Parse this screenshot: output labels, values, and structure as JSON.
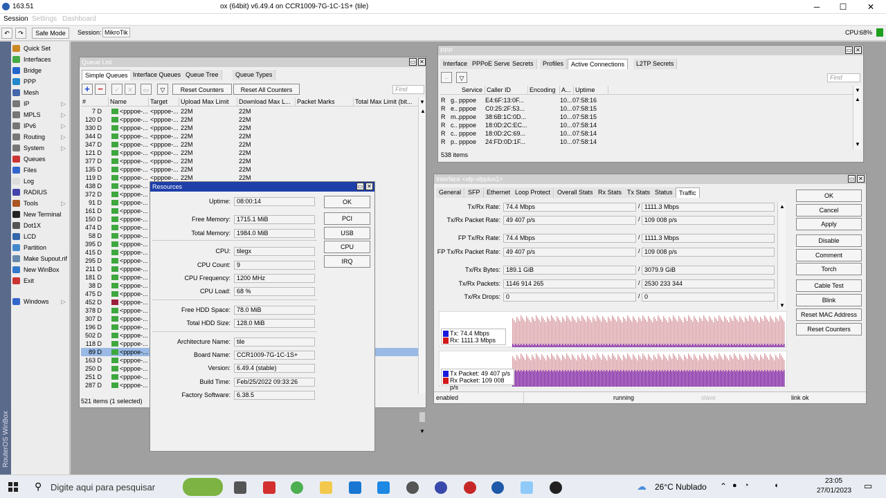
{
  "titlebar": {
    "left": "163.51",
    "title": "ox (64bit) v6.49.4 on CCR1009-7G-1C-1S+ (tile)",
    "min": "─",
    "max": "☐",
    "close": "✕"
  },
  "menu": {
    "session": "Session",
    "settings": "Settings",
    "dashboard": "Dashboard"
  },
  "toolbar": {
    "undo": "↶",
    "redo": "↷",
    "safe_mode": "Safe Mode",
    "session_label": "Session:",
    "session_value": "MikroTik",
    "cpu_label": "CPU:",
    "cpu_value": "68%"
  },
  "sidebar": {
    "brand": "RouterOS WinBox",
    "items": [
      {
        "label": "Quick Set",
        "color": "#cc8822",
        "arrow": ""
      },
      {
        "label": "Interfaces",
        "color": "#44aa44",
        "arrow": ""
      },
      {
        "label": "Bridge",
        "color": "#2266cc",
        "arrow": ""
      },
      {
        "label": "PPP",
        "color": "#2288cc",
        "arrow": ""
      },
      {
        "label": "Mesh",
        "color": "#4466aa",
        "arrow": ""
      },
      {
        "label": "IP",
        "color": "#777777",
        "arrow": "▷"
      },
      {
        "label": "MPLS",
        "color": "#777777",
        "arrow": "▷"
      },
      {
        "label": "IPv6",
        "color": "#777777",
        "arrow": "▷"
      },
      {
        "label": "Routing",
        "color": "#777777",
        "arrow": "▷"
      },
      {
        "label": "System",
        "color": "#777777",
        "arrow": "▷"
      },
      {
        "label": "Queues",
        "color": "#cc3333",
        "arrow": ""
      },
      {
        "label": "Files",
        "color": "#3366cc",
        "arrow": ""
      },
      {
        "label": "Log",
        "color": "#dddddd",
        "arrow": ""
      },
      {
        "label": "RADIUS",
        "color": "#4444aa",
        "arrow": ""
      },
      {
        "label": "Tools",
        "color": "#aa5522",
        "arrow": "▷"
      },
      {
        "label": "New Terminal",
        "color": "#222222",
        "arrow": ""
      },
      {
        "label": "Dot1X",
        "color": "#555555",
        "arrow": ""
      },
      {
        "label": "LCD",
        "color": "#3366aa",
        "arrow": ""
      },
      {
        "label": "Partition",
        "color": "#4488cc",
        "arrow": ""
      },
      {
        "label": "Make Supout.rif",
        "color": "#6688aa",
        "arrow": ""
      },
      {
        "label": "New WinBox",
        "color": "#3377cc",
        "arrow": ""
      },
      {
        "label": "Exit",
        "color": "#cc3333",
        "arrow": ""
      },
      {
        "label": "Windows",
        "color": "#3366cc",
        "arrow": "▷"
      }
    ]
  },
  "queue_list": {
    "title": "Queue List",
    "tabs": [
      "Simple Queues",
      "Interface Queues",
      "Queue Tree",
      "Queue Types"
    ],
    "reset_counters": "Reset Counters",
    "reset_all_counters": "Reset All Counters",
    "find": "Find",
    "columns": [
      "#",
      "Name",
      "Target",
      "Upload Max Limit",
      "Download Max L...",
      "Packet Marks",
      "Total Max Limit (bit..."
    ],
    "rows": [
      {
        "num": "7 D",
        "name": "<pppoe-...",
        "target": "<pppoe-...",
        "up": "22M",
        "down": "22M"
      },
      {
        "num": "120 D",
        "name": "<pppoe-...",
        "target": "<pppoe-...",
        "up": "22M",
        "down": "22M"
      },
      {
        "num": "330 D",
        "name": "<pppoe-...",
        "target": "<pppoe-...",
        "up": "22M",
        "down": "22M"
      },
      {
        "num": "344 D",
        "name": "<pppoe-...",
        "target": "<pppoe-...",
        "up": "22M",
        "down": "22M"
      },
      {
        "num": "347 D",
        "name": "<pppoe-...",
        "target": "<pppoe-...",
        "up": "22M",
        "down": "22M"
      },
      {
        "num": "121 D",
        "name": "<pppoe-...",
        "target": "<pppoe-...",
        "up": "22M",
        "down": "22M"
      },
      {
        "num": "377 D",
        "name": "<pppoe-...",
        "target": "<pppoe-...",
        "up": "22M",
        "down": "22M"
      },
      {
        "num": "135 D",
        "name": "<pppoe-...",
        "target": "<pppoe-...",
        "up": "22M",
        "down": "22M"
      },
      {
        "num": "119 D",
        "name": "<pppoe-...",
        "target": "<pppoe-...",
        "up": "22M",
        "down": "22M"
      },
      {
        "num": "438 D",
        "name": "<pppoe-...",
        "target": "",
        "up": "",
        "down": ""
      },
      {
        "num": "372 D",
        "name": "<pppoe-...",
        "target": "",
        "up": "",
        "down": ""
      },
      {
        "num": "91 D",
        "name": "<pppoe-...",
        "target": "",
        "up": "",
        "down": ""
      },
      {
        "num": "161 D",
        "name": "<pppoe-...",
        "target": "",
        "up": "",
        "down": ""
      },
      {
        "num": "150 D",
        "name": "<pppoe-...",
        "target": "",
        "up": "",
        "down": ""
      },
      {
        "num": "474 D",
        "name": "<pppoe-...",
        "target": "",
        "up": "",
        "down": ""
      },
      {
        "num": "58 D",
        "name": "<pppoe-...",
        "target": "",
        "up": "",
        "down": ""
      },
      {
        "num": "395 D",
        "name": "<pppoe-...",
        "target": "",
        "up": "",
        "down": ""
      },
      {
        "num": "415 D",
        "name": "<pppoe-...",
        "target": "",
        "up": "",
        "down": ""
      },
      {
        "num": "295 D",
        "name": "<pppoe-...",
        "target": "",
        "up": "",
        "down": ""
      },
      {
        "num": "211 D",
        "name": "<pppoe-...",
        "target": "",
        "up": "",
        "down": ""
      },
      {
        "num": "181 D",
        "name": "<pppoe-...",
        "target": "",
        "up": "",
        "down": ""
      },
      {
        "num": "38 D",
        "name": "<pppoe-...",
        "target": "",
        "up": "",
        "down": ""
      },
      {
        "num": "475 D",
        "name": "<pppoe-...",
        "target": "",
        "up": "",
        "down": ""
      },
      {
        "num": "452 D",
        "name": "<pppoe-...",
        "target": "",
        "up": "",
        "down": ""
      },
      {
        "num": "378 D",
        "name": "<pppoe-...",
        "target": "",
        "up": "",
        "down": ""
      },
      {
        "num": "307 D",
        "name": "<pppoe-...",
        "target": "",
        "up": "",
        "down": ""
      },
      {
        "num": "196 D",
        "name": "<pppoe-...",
        "target": "",
        "up": "",
        "down": ""
      },
      {
        "num": "502 D",
        "name": "<pppoe-...",
        "target": "",
        "up": "",
        "down": ""
      },
      {
        "num": "118 D",
        "name": "<pppoe-...",
        "target": "",
        "up": "",
        "down": ""
      },
      {
        "num": "89 D",
        "name": "<pppoe-...",
        "target": "",
        "up": "",
        "down": ""
      },
      {
        "num": "163 D",
        "name": "<pppoe-...",
        "target": "",
        "up": "",
        "down": ""
      },
      {
        "num": "250 D",
        "name": "<pppoe-...",
        "target": "",
        "up": "",
        "down": ""
      },
      {
        "num": "251 D",
        "name": "<pppoe-...",
        "target": "",
        "up": "",
        "down": ""
      },
      {
        "num": "287 D",
        "name": "<pppoe-...",
        "target": "",
        "up": "",
        "down": ""
      }
    ],
    "selected_index": 29,
    "status": "521 items (1 selected)"
  },
  "resources": {
    "title": "Resources",
    "fields": [
      {
        "label": "Uptime:",
        "value": "08:00:14"
      },
      {
        "label": "Free Memory:",
        "value": "1715.1 MiB"
      },
      {
        "label": "Total Memory:",
        "value": "1984.0 MiB"
      },
      {
        "label": "CPU:",
        "value": "tilegx"
      },
      {
        "label": "CPU Count:",
        "value": "9"
      },
      {
        "label": "CPU Frequency:",
        "value": "1200 MHz"
      },
      {
        "label": "CPU Load:",
        "value": "68 %"
      },
      {
        "label": "Free HDD Space:",
        "value": "78.0 MiB"
      },
      {
        "label": "Total HDD Size:",
        "value": "128.0 MiB"
      },
      {
        "label": "Architecture Name:",
        "value": "tile"
      },
      {
        "label": "Board Name:",
        "value": "CCR1009-7G-1C-1S+"
      },
      {
        "label": "Version:",
        "value": "6.49.4 (stable)"
      },
      {
        "label": "Build Time:",
        "value": "Feb/25/2022 09:33:26"
      },
      {
        "label": "Factory Software:",
        "value": "6.38.5"
      }
    ],
    "buttons": [
      "OK",
      "PCI",
      "USB",
      "CPU",
      "IRQ"
    ]
  },
  "ppp": {
    "title": "PPP",
    "tabs": [
      "Interface",
      "PPPoE Servers",
      "Secrets",
      "Profiles",
      "Active Connections",
      "L2TP Secrets"
    ],
    "find": "Find",
    "columns": [
      "",
      "Service",
      "Caller ID",
      "Encoding",
      "A...",
      "Uptime"
    ],
    "rows": [
      {
        "flag": "R",
        "n": "g..",
        "service": "pppoe",
        "caller": "E4:6F:13:0F...",
        "enc": "",
        "a": "10...",
        "uptime": "07:58:16"
      },
      {
        "flag": "R",
        "n": "e..",
        "service": "pppoe",
        "caller": "C0:25:2F:53...",
        "enc": "",
        "a": "10...",
        "uptime": "07:58:15"
      },
      {
        "flag": "R",
        "n": "m..",
        "service": "pppoe",
        "caller": "38:6B:1C:0D...",
        "enc": "",
        "a": "10...",
        "uptime": "07:58:15"
      },
      {
        "flag": "R",
        "n": "c..",
        "service": "pppoe",
        "caller": "18:0D:2C:EC...",
        "enc": "",
        "a": "10...",
        "uptime": "07:58:14"
      },
      {
        "flag": "R",
        "n": "c..",
        "service": "pppoe",
        "caller": "18:0D:2C:69...",
        "enc": "",
        "a": "10...",
        "uptime": "07:58:14"
      },
      {
        "flag": "R",
        "n": "p..",
        "service": "pppoe",
        "caller": "24:FD:0D:1F...",
        "enc": "",
        "a": "10...",
        "uptime": "07:58:14"
      }
    ],
    "status": "538 items"
  },
  "iface": {
    "title": "Interface <sfp-sfpplus1>",
    "tabs": [
      "General",
      "SFP",
      "Ethernet",
      "Loop Protect",
      "Overall Stats",
      "Rx Stats",
      "Tx Stats",
      "Status",
      "Traffic"
    ],
    "stats": [
      {
        "label": "Tx/Rx Rate:",
        "tx": "74.4 Mbps",
        "rx": "1111.3 Mbps"
      },
      {
        "label": "Tx/Rx Packet Rate:",
        "tx": "49 407 p/s",
        "rx": "109 008 p/s"
      },
      {
        "label": "FP Tx/Rx Rate:",
        "tx": "74.4 Mbps",
        "rx": "1111.3 Mbps"
      },
      {
        "label": "FP Tx/Rx Packet Rate:",
        "tx": "49 407 p/s",
        "rx": "109 008 p/s"
      },
      {
        "label": "Tx/Rx Bytes:",
        "tx": "189.1 GiB",
        "rx": "3079.9 GiB"
      },
      {
        "label": "Tx/Rx Packets:",
        "tx": "1146 914 265",
        "rx": "2530 233 344"
      },
      {
        "label": "Tx/Rx Drops:",
        "tx": "0",
        "rx": "0"
      }
    ],
    "slash": "/",
    "graph1": {
      "tx": "Tx:  74.4 Mbps",
      "rx": "Rx:  1111.3 Mbps",
      "tx_color": "#1a1adc",
      "rx_color": "#d01818"
    },
    "graph2": {
      "tx": "Tx Packet:  49 407 p/s",
      "rx": "Rx Packet:  109 008 p/s"
    },
    "buttons": [
      "OK",
      "Cancel",
      "Apply",
      "Disable",
      "Comment",
      "Torch",
      "Cable Test",
      "Blink",
      "Reset MAC Address",
      "Reset Counters"
    ],
    "status": {
      "enabled": "enabled",
      "running": "running",
      "slave": "slave",
      "link": "link ok"
    }
  },
  "taskbar": {
    "search": "Digite aqui para pesquisar",
    "weather": "26°C  Nublado",
    "time": "23:05",
    "date": "27/01/2023"
  }
}
